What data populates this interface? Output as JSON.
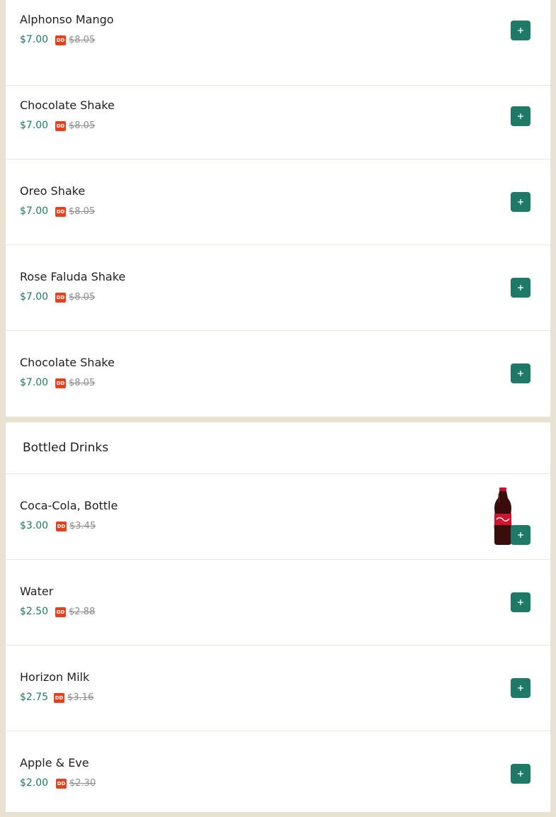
{
  "currency_badge": "DD",
  "colors": {
    "background": "#e8e2d2",
    "accent": "#1e7a67",
    "price": "#1f7a66",
    "badge": "#e8401c"
  },
  "top_items": [
    {
      "name": "Alphonso Mango",
      "price": "$7.00",
      "old_price": "$8.05"
    },
    {
      "name": "Chocolate Shake",
      "price": "$7.00",
      "old_price": "$8.05"
    },
    {
      "name": "Oreo Shake",
      "price": "$7.00",
      "old_price": "$8.05"
    },
    {
      "name": "Rose Faluda Shake",
      "price": "$7.00",
      "old_price": "$8.05"
    },
    {
      "name": "Chocolate Shake",
      "price": "$7.00",
      "old_price": "$8.05"
    }
  ],
  "bottled_section": {
    "title": "Bottled Drinks",
    "items": [
      {
        "name": "Coca-Cola, Bottle",
        "price": "$3.00",
        "old_price": "$3.45",
        "image": "coca-cola-bottle-image"
      },
      {
        "name": "Water",
        "price": "$2.50",
        "old_price": "$2.88"
      },
      {
        "name": "Horizon Milk",
        "price": "$2.75",
        "old_price": "$3.16"
      },
      {
        "name": "Apple & Eve",
        "price": "$2.00",
        "old_price": "$2.30"
      }
    ]
  }
}
